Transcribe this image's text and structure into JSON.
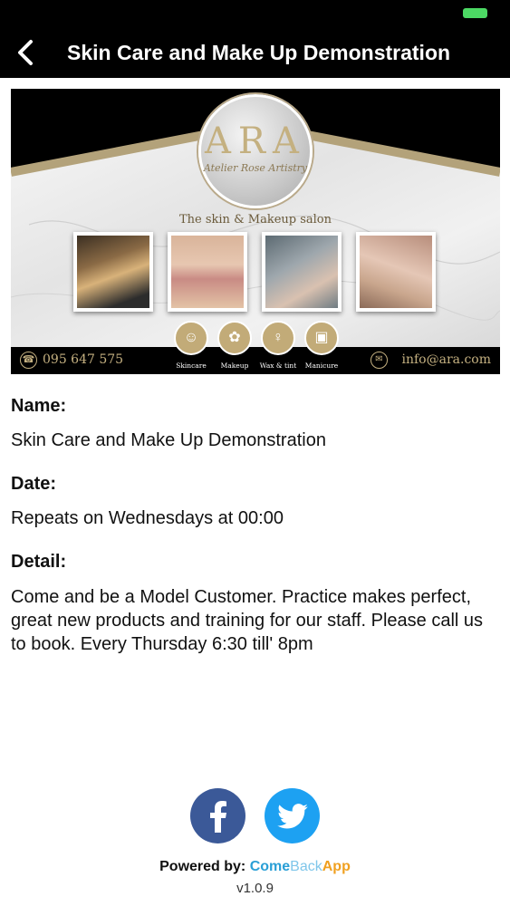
{
  "status_bar": {
    "battery_color": "#4cd964"
  },
  "nav": {
    "title": "Skin Care and Make Up Demonstration",
    "back_icon": "chevron-left-icon"
  },
  "banner": {
    "logo_letters": "ARA",
    "logo_subtitle": "Atelier Rose Artistry",
    "tagline": "The skin & Makeup salon",
    "phone": "095 647 575",
    "email": "info@ara.com",
    "services": [
      "Skincare",
      "Makeup",
      "Wax & tint",
      "Manicure"
    ],
    "accent_color": "#c4b080"
  },
  "fields": {
    "name_label": "Name:",
    "name_value": "Skin Care and Make Up Demonstration",
    "date_label": "Date:",
    "date_value": "Repeats on Wednesdays at 00:00",
    "detail_label": "Detail:",
    "detail_value": "Come and be a Model Customer. Practice makes perfect, great new products and training for our staff. Please call us to book. Every Thursday 6:30 till' 8pm"
  },
  "social": {
    "facebook_color": "#3b5998",
    "twitter_color": "#1da1f2"
  },
  "footer": {
    "powered_label": "Powered by:",
    "brand_part1": "Come",
    "brand_part2": "Back",
    "brand_part3": "App",
    "version": "v1.0.9"
  }
}
